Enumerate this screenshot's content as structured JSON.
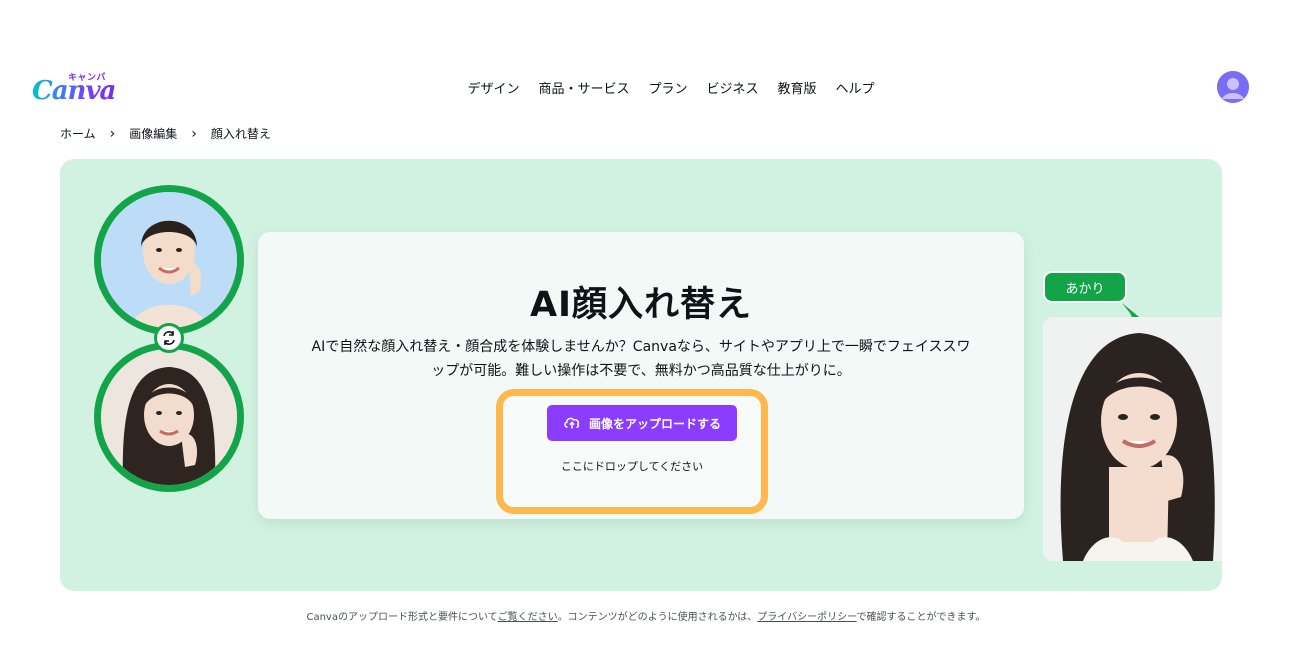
{
  "logo": {
    "main": "Canva",
    "kana": "キャンバ"
  },
  "nav": [
    "デザイン",
    "商品・サービス",
    "プラン",
    "ビジネス",
    "教育版",
    "ヘルプ"
  ],
  "breadcrumb": [
    "ホーム",
    "画像編集",
    "顔入れ替え"
  ],
  "hero": {
    "title": "AI顔入れ替え",
    "description": "AIで自然な顔入れ替え・顔合成を体験しませんか？Canvaなら、サイトやアプリ上で一瞬でフェイススワップが可能。難しい操作は不要で、無料かつ高品質な仕上がりに。",
    "upload_button": "画像をアップロードする",
    "drop_hint": "ここにドロップしてください",
    "name_tag": "あかり"
  },
  "footnote": {
    "part1": "Canvaのアップロード形式と要件について",
    "link1": "ご覧ください",
    "part2": "。コンテンツがどのように使用されるかは、",
    "link2": "プライバシーポリシー",
    "part3": "で確認することができます。"
  },
  "colors": {
    "brand_purple": "#8b3dff",
    "hero_bg": "#d1f2e0",
    "green": "#13a44a",
    "highlight": "#ffb84d"
  },
  "icons": [
    "user-avatar-icon",
    "chevron-right-icon",
    "swap-arrows-icon",
    "cloud-upload-icon"
  ]
}
